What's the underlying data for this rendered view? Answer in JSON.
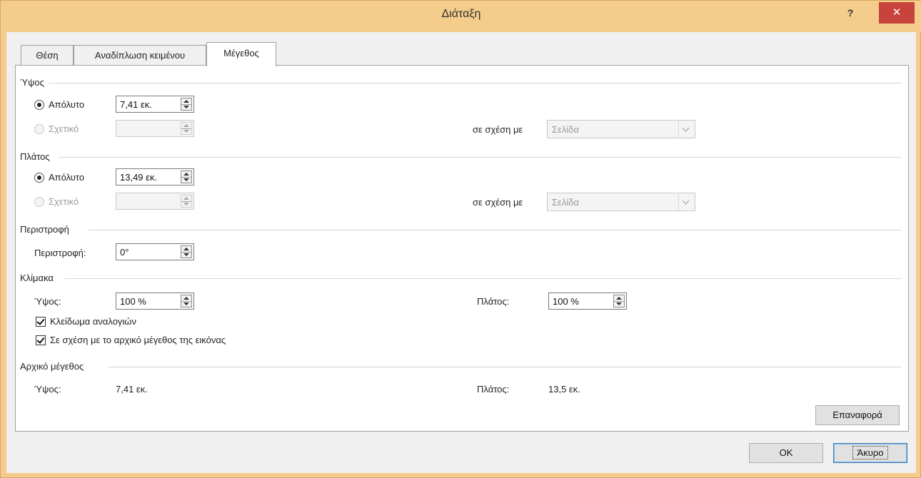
{
  "window": {
    "title": "Διάταξη",
    "help_label": "?",
    "close_label": "✕"
  },
  "tabs": [
    {
      "label": "Θέση",
      "active": false
    },
    {
      "label": "Αναδίπλωση κειμένου",
      "active": false
    },
    {
      "label": "Μέγεθος",
      "active": true
    }
  ],
  "height": {
    "section_label": "Ύψος",
    "absolute_label": "Απόλυτο",
    "absolute_value": "7,41 εκ.",
    "relative_label": "Σχετικό",
    "relative_value": "",
    "relative_to_label": "σε σχέση με",
    "relative_to_value": "Σελίδα"
  },
  "width": {
    "section_label": "Πλάτος",
    "absolute_label": "Απόλυτο",
    "absolute_value": "13,49 εκ.",
    "relative_label": "Σχετικό",
    "relative_value": "",
    "relative_to_label": "σε σχέση με",
    "relative_to_value": "Σελίδα"
  },
  "rotation": {
    "section_label": "Περιστροφή",
    "field_label": "Περιστροφή:",
    "value": "0°"
  },
  "scale": {
    "section_label": "Κλίμακα",
    "height_label": "Ύψος:",
    "height_value": "100 %",
    "width_label": "Πλάτος:",
    "width_value": "100 %",
    "lock_aspect_label": "Κλείδωμα αναλογιών",
    "lock_aspect_checked": true,
    "relative_original_label": "Σε σχέση με το αρχικό μέγεθος της εικόνας",
    "relative_original_checked": true
  },
  "original_size": {
    "section_label": "Αρχικό μέγεθος",
    "height_label": "Ύψος:",
    "height_value": "7,41 εκ.",
    "width_label": "Πλάτος:",
    "width_value": "13,5 εκ.",
    "reset_label": "Επαναφορά"
  },
  "footer": {
    "ok_label": "OK",
    "cancel_label": "Άκυρο"
  },
  "colors": {
    "frame": "#f4cc8c",
    "close_button": "#c7433c",
    "panel": "#ffffff",
    "dialog_bg": "#f0f0f0"
  }
}
